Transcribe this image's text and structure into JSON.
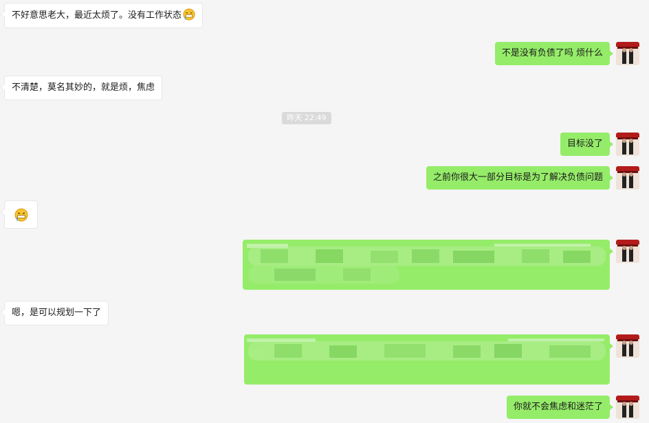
{
  "conversation": {
    "timestamp": "昨天 22:49",
    "messages": [
      {
        "side": "left",
        "text": "不好意思老大，最近太烦了。没有工作状态",
        "emoji": "grimace-emoji"
      },
      {
        "side": "right",
        "text": "不是没有负债了吗 烦什么"
      },
      {
        "side": "left",
        "text": "不清楚，莫名其妙的，就是烦，焦虑"
      },
      {
        "side": "right",
        "text": "目标没了"
      },
      {
        "side": "right",
        "text": "之前你很大一部分目标是为了解决负债问题"
      },
      {
        "side": "left",
        "text": "",
        "emoji": "grimace-emoji"
      },
      {
        "side": "right",
        "text": "",
        "redacted": true
      },
      {
        "side": "left",
        "text": "嗯，是可以规划一下了"
      },
      {
        "side": "right",
        "text": "",
        "redacted": true
      },
      {
        "side": "right",
        "text": "你就不会焦虑和迷茫了"
      }
    ]
  },
  "colors": {
    "background": "#f5f5f5",
    "outgoing_bubble": "#95ec69",
    "incoming_bubble": "#ffffff",
    "timestamp_bg": "#dadada"
  }
}
